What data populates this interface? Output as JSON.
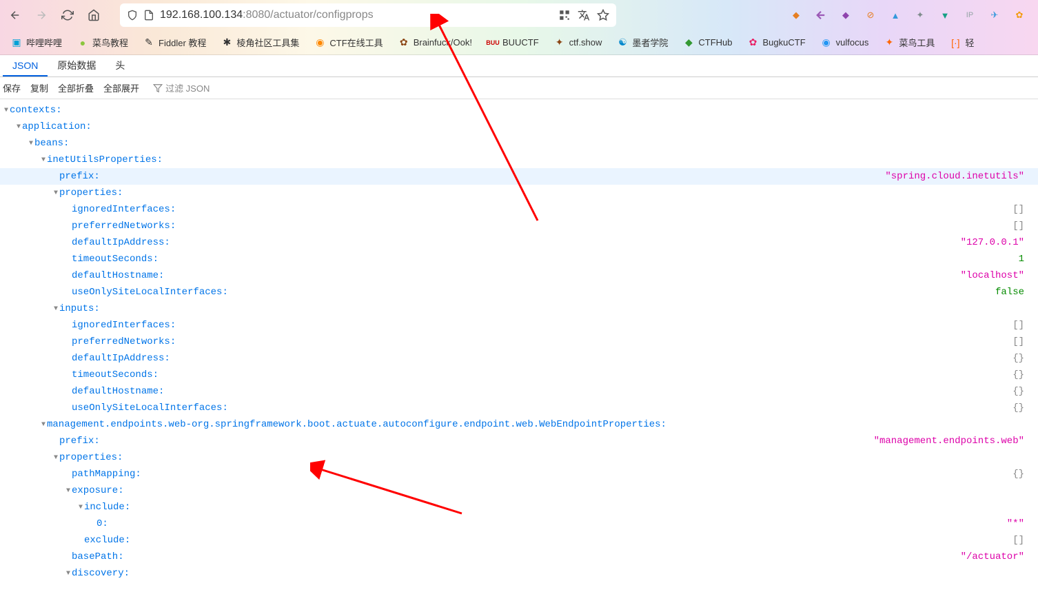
{
  "url": {
    "host": "192.168.100.134",
    "path": ":8080/actuator/configprops"
  },
  "bookmarks": [
    {
      "label": "哔哩哔哩",
      "color": "#00a1d6"
    },
    {
      "label": "菜鸟教程",
      "color": "#8cc63f"
    },
    {
      "label": "Fiddler 教程",
      "color": "#333"
    },
    {
      "label": "棱角社区工具集",
      "color": "#333"
    },
    {
      "label": "CTF在线工具",
      "color": "#ff8800"
    },
    {
      "label": "Brainfuck/Ook!",
      "color": "#8b4513"
    },
    {
      "label": "BUUCTF",
      "color": "#cc0000"
    },
    {
      "label": "ctf.show",
      "color": "#8b4513"
    },
    {
      "label": "墨者学院",
      "color": "#0088cc"
    },
    {
      "label": "CTFHub",
      "color": "#339933"
    },
    {
      "label": "BugkuCTF",
      "color": "#e91e63"
    },
    {
      "label": "vulfocus",
      "color": "#2196f3"
    },
    {
      "label": "菜鸟工具",
      "color": "#ff6600"
    },
    {
      "label": "轻",
      "color": "#ff6600"
    }
  ],
  "tabs": {
    "json": "JSON",
    "raw": "原始数据",
    "headers": "头"
  },
  "toolbar": {
    "save": "保存",
    "copy": "复制",
    "collapse": "全部折叠",
    "expand": "全部展开",
    "filter": "过滤 JSON"
  },
  "json": {
    "contexts": "contexts",
    "application": "application",
    "beans": "beans",
    "inetUtilsProperties": "inetUtilsProperties",
    "prefix": "prefix",
    "prefix_val": "\"spring.cloud.inetutils\"",
    "properties": "properties",
    "ignoredInterfaces": "ignoredInterfaces",
    "preferredNetworks": "preferredNetworks",
    "defaultIpAddress": "defaultIpAddress",
    "defaultIpAddress_val": "\"127.0.0.1\"",
    "timeoutSeconds": "timeoutSeconds",
    "timeoutSeconds_val": "1",
    "defaultHostname": "defaultHostname",
    "defaultHostname_val": "\"localhost\"",
    "useOnlySiteLocalInterfaces": "useOnlySiteLocalInterfaces",
    "useOnly_val": "false",
    "inputs": "inputs",
    "empty_arr": "[]",
    "empty_obj": "{}",
    "mgmt_key": "management.endpoints.web-org.springframework.boot.actuate.autoconfigure.endpoint.web.WebEndpointProperties",
    "mgmt_prefix_val": "\"management.endpoints.web\"",
    "pathMapping": "pathMapping",
    "exposure": "exposure",
    "include": "include",
    "zero": "0",
    "star_val": "\"*\"",
    "exclude": "exclude",
    "basePath": "basePath",
    "basePath_val": "\"/actuator\"",
    "discovery": "discovery"
  }
}
